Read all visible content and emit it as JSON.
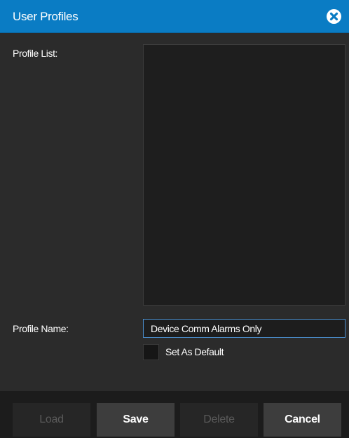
{
  "dialog": {
    "title": "User Profiles",
    "close_icon": "close-circle-icon"
  },
  "form": {
    "profile_list_label": "Profile List:",
    "profile_list_items": [],
    "profile_name_label": "Profile Name:",
    "profile_name_value": "Device Comm Alarms Only",
    "set_default_label": "Set As Default",
    "set_default_checked": false
  },
  "buttons": {
    "load": "Load",
    "save": "Save",
    "delete": "Delete",
    "cancel": "Cancel"
  },
  "colors": {
    "titlebar": "#0a7cc4",
    "background": "#2b2b2b",
    "input_border": "#4b8fcf"
  }
}
